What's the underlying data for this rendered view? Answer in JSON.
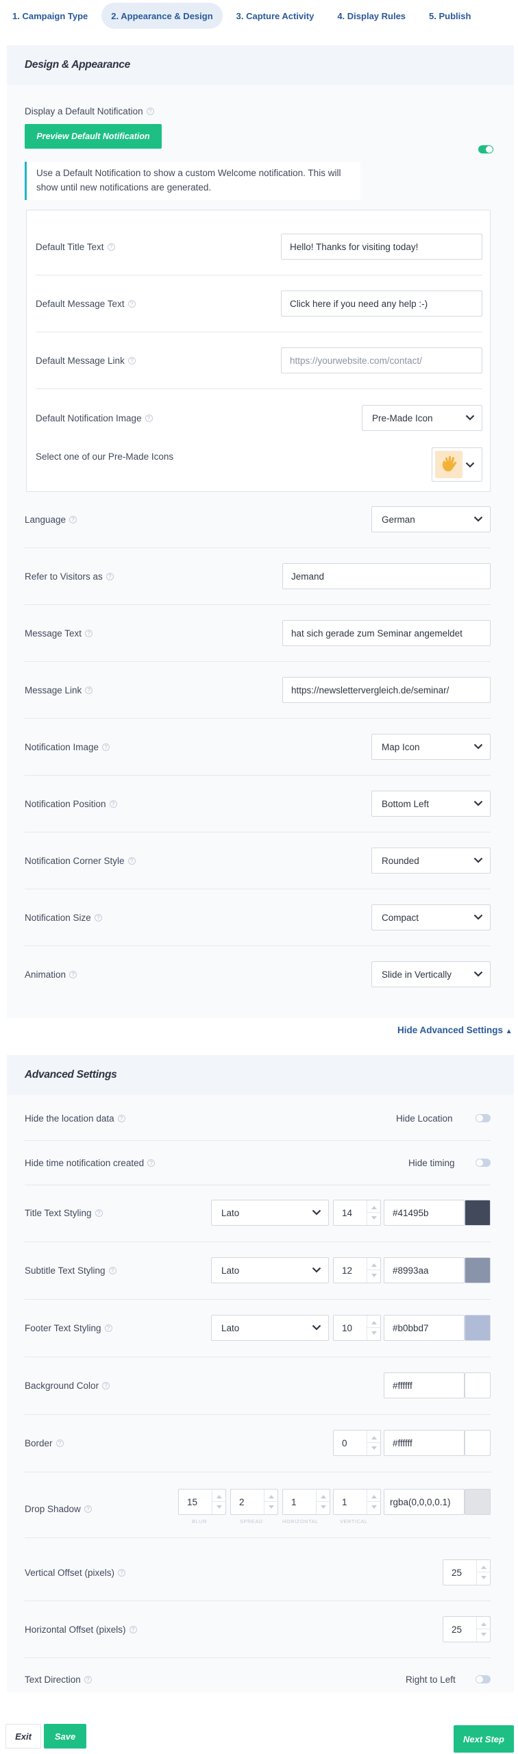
{
  "tabs": [
    {
      "label": "1. Campaign Type"
    },
    {
      "label": "2. Appearance & Design"
    },
    {
      "label": "3. Capture Activity"
    },
    {
      "label": "4. Display Rules"
    },
    {
      "label": "5. Publish"
    }
  ],
  "design": {
    "title": "Design & Appearance",
    "default_notification_label": "Display a Default Notification",
    "preview_button": "Preview Default Notification",
    "default_notification_on": true,
    "info_text": "Use a Default Notification to show a custom Welcome notification. This will show until new notifications are generated.",
    "default_title": {
      "label": "Default Title Text",
      "value": "Hello! Thanks for visiting today!"
    },
    "default_message": {
      "label": "Default Message Text",
      "value": "Click here if you need any help :-)"
    },
    "default_link": {
      "label": "Default Message Link",
      "placeholder": "https://yourwebsite.com/contact/"
    },
    "default_image": {
      "label": "Default Notification Image",
      "value": "Pre-Made Icon"
    },
    "premade_icon": {
      "label": "Select one of our Pre-Made Icons",
      "icon": "waving-hand-icon"
    },
    "language": {
      "label": "Language",
      "value": "German"
    },
    "visitors": {
      "label": "Refer to Visitors as",
      "value": "Jemand"
    },
    "message_text": {
      "label": "Message Text",
      "value": "hat sich gerade zum Seminar angemeldet"
    },
    "message_link": {
      "label": "Message Link",
      "value": "https://newslettervergleich.de/seminar/"
    },
    "notification_image": {
      "label": "Notification Image",
      "value": "Map Icon"
    },
    "notification_position": {
      "label": "Notification Position",
      "value": "Bottom Left"
    },
    "corner_style": {
      "label": "Notification Corner Style",
      "value": "Rounded"
    },
    "notification_size": {
      "label": "Notification Size",
      "value": "Compact"
    },
    "animation": {
      "label": "Animation",
      "value": "Slide in Vertically"
    }
  },
  "hide_advanced_link": "Hide Advanced Settings",
  "advanced": {
    "title": "Advanced Settings",
    "hide_location": {
      "label": "Hide the location data",
      "toggle_label": "Hide Location",
      "on": false
    },
    "hide_time": {
      "label": "Hide time notification created",
      "toggle_label": "Hide timing",
      "on": false
    },
    "title_style": {
      "label": "Title Text Styling",
      "font": "Lato",
      "size": "14",
      "color": "#41495b"
    },
    "subtitle_style": {
      "label": "Subtitle Text Styling",
      "font": "Lato",
      "size": "12",
      "color": "#8993aa"
    },
    "footer_style": {
      "label": "Footer Text Styling",
      "font": "Lato",
      "size": "10",
      "color": "#b0bbd7"
    },
    "background": {
      "label": "Background Color",
      "color": "#ffffff"
    },
    "border": {
      "label": "Border",
      "width": "0",
      "color": "#ffffff"
    },
    "drop_shadow": {
      "label": "Drop Shadow",
      "blur": "15",
      "spread": "2",
      "horizontal": "1",
      "vertical": "1",
      "blur_label": "BLUR",
      "spread_label": "SPREAD",
      "horizontal_label": "HORIZONTAL",
      "vertical_label": "VERTICAL",
      "color": "rgba(0,0,0,0.1)",
      "swatch_color": "#e1e3e6"
    },
    "vertical_offset": {
      "label": "Vertical Offset (pixels)",
      "value": "25"
    },
    "horizontal_offset": {
      "label": "Horizontal Offset (pixels)",
      "value": "25"
    },
    "text_direction": {
      "label": "Text Direction",
      "toggle_label": "Right to Left",
      "on": false
    }
  },
  "footer": {
    "exit": "Exit",
    "save": "Save",
    "next": "Next Step"
  },
  "colors": {
    "accent_green": "#1dbf85",
    "link_blue": "#2a5a9a"
  }
}
